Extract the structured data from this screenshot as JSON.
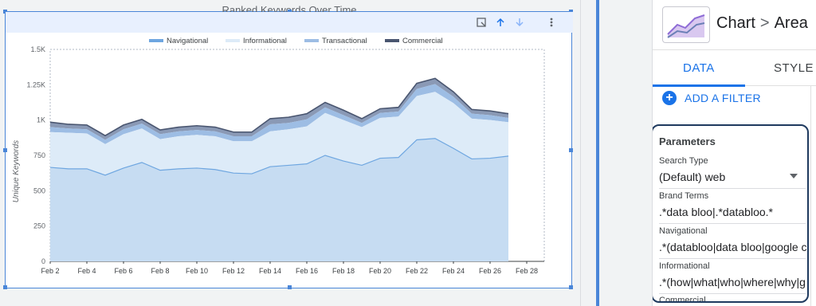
{
  "chart": {
    "title": "Ranked Keywords Over Time",
    "colors": {
      "navigational": "#c6dcf2",
      "informational": "#ddebf8",
      "transactional": "#9dbde4",
      "commercial": "#8a99b5",
      "navigational_line": "#6ea6e0",
      "commercial_line": "#4a5670"
    }
  },
  "chart_data": {
    "type": "area",
    "title": "Ranked Keywords Over Time",
    "xlabel": "",
    "ylabel": "Unique Keywords",
    "ylim": [
      0,
      1500
    ],
    "y_ticks": [
      "0",
      "250",
      "500",
      "750",
      "1K",
      "1.25K",
      "1.5K"
    ],
    "x_ticks": [
      "Feb 2",
      "Feb 4",
      "Feb 6",
      "Feb 8",
      "Feb 10",
      "Feb 12",
      "Feb 14",
      "Feb 16",
      "Feb 18",
      "Feb 20",
      "Feb 22",
      "Feb 24",
      "Feb 26",
      "Feb 28"
    ],
    "stacked": true,
    "legend_position": "top",
    "categories": [
      "Feb 2",
      "Feb 3",
      "Feb 4",
      "Feb 5",
      "Feb 6",
      "Feb 7",
      "Feb 8",
      "Feb 9",
      "Feb 10",
      "Feb 11",
      "Feb 12",
      "Feb 13",
      "Feb 14",
      "Feb 15",
      "Feb 16",
      "Feb 17",
      "Feb 18",
      "Feb 19",
      "Feb 20",
      "Feb 21",
      "Feb 22",
      "Feb 23",
      "Feb 24",
      "Feb 25",
      "Feb 26",
      "Feb 27"
    ],
    "series": [
      {
        "name": "Navigational",
        "values": [
          665,
          655,
          655,
          610,
          660,
          700,
          645,
          655,
          660,
          650,
          625,
          620,
          670,
          680,
          690,
          750,
          710,
          680,
          730,
          735,
          860,
          870,
          800,
          725,
          730,
          745
        ]
      },
      {
        "name": "Informational",
        "values": [
          250,
          255,
          250,
          220,
          240,
          240,
          220,
          230,
          235,
          235,
          225,
          230,
          250,
          255,
          265,
          300,
          290,
          270,
          285,
          290,
          310,
          330,
          320,
          285,
          270,
          240
        ]
      },
      {
        "name": "Transactional",
        "values": [
          35,
          30,
          30,
          30,
          35,
          35,
          35,
          35,
          35,
          35,
          35,
          35,
          50,
          45,
          50,
          40,
          35,
          30,
          35,
          35,
          50,
          55,
          45,
          35,
          35,
          30
        ]
      },
      {
        "name": "Commercial",
        "values": [
          35,
          30,
          30,
          30,
          30,
          30,
          30,
          30,
          30,
          30,
          30,
          30,
          40,
          40,
          40,
          35,
          35,
          30,
          30,
          30,
          40,
          40,
          35,
          30,
          30,
          30
        ]
      }
    ]
  },
  "panel": {
    "breadcrumb_chart": "Chart",
    "breadcrumb_sep": ">",
    "breadcrumb_type": "Area",
    "tab_data": "DATA",
    "tab_style": "STYLE",
    "add_filter": "ADD A FILTER",
    "add_filter_icon": "+",
    "params_title": "Parameters",
    "params": [
      {
        "label": "Search Type",
        "value": "(Default) web"
      },
      {
        "label": "Brand Terms",
        "value": ".*data bloo|.*databloo.*"
      },
      {
        "label": "Navigational",
        "value": ".*(databloo|data bloo|google c"
      },
      {
        "label": "Informational",
        "value": ".*(how|what|who|where|why|g"
      },
      {
        "label": "Commercial",
        "value": ""
      }
    ]
  }
}
